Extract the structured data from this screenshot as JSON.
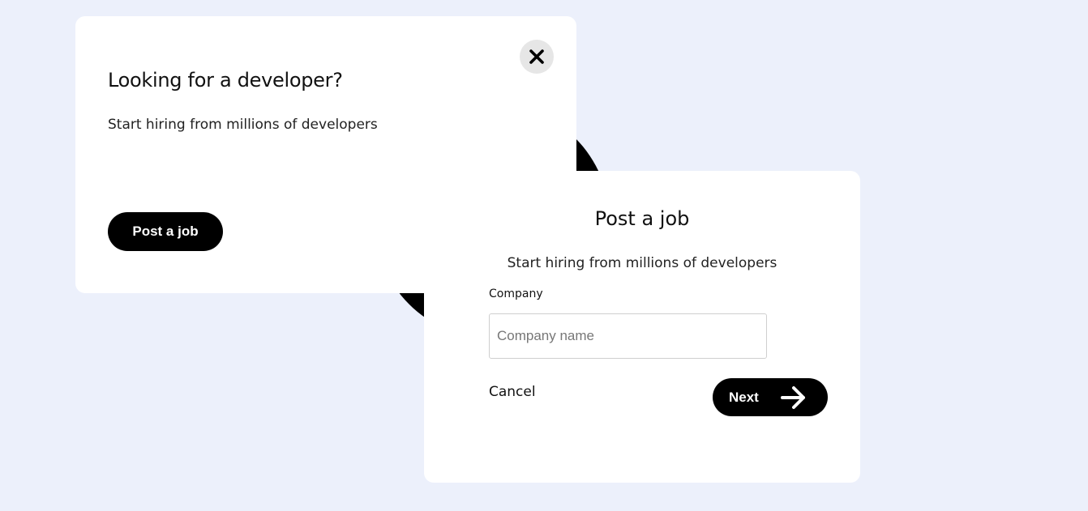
{
  "hire_card": {
    "title": "Looking for a developer?",
    "subtitle": "Start hiring from millions of developers",
    "post_button_label": "Post a job",
    "close_icon": "close-icon"
  },
  "post_card": {
    "title": "Post a job",
    "subtitle": "Start hiring from millions of developers",
    "company_label": "Company",
    "company_placeholder": "Company name",
    "company_value": "",
    "cancel_label": "Cancel",
    "next_label": "Next",
    "next_icon": "arrow-right-icon"
  },
  "colors": {
    "background": "#ecf0fb",
    "card": "#ffffff",
    "primary_button": "#000000",
    "close_button": "#e6e6e6"
  }
}
